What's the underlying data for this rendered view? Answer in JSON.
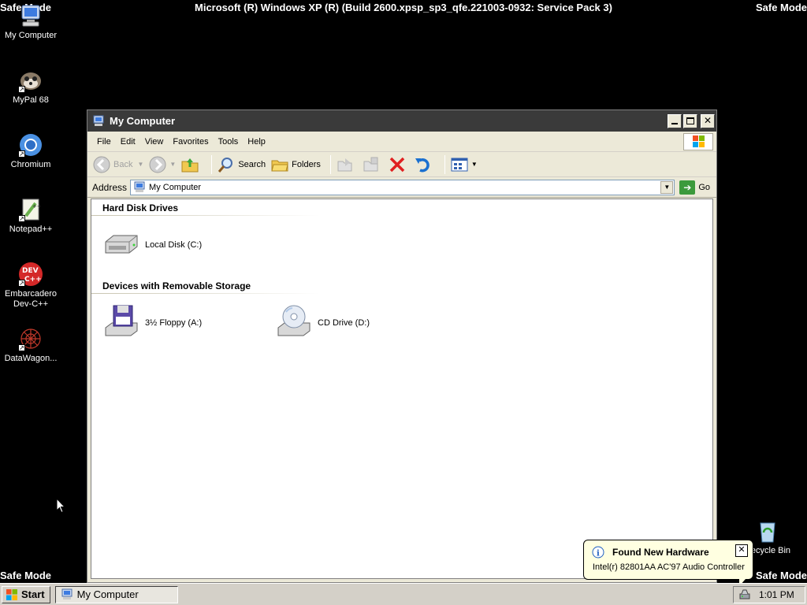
{
  "screen": {
    "safe_mode_label": "Safe Mode",
    "build_text": "Microsoft (R) Windows XP (R) (Build 2600.xpsp_sp3_qfe.221003-0932: Service Pack 3)"
  },
  "desktop_icons": [
    {
      "label": "My Computer",
      "icon": "my-computer-icon"
    },
    {
      "label": "MyPal 68",
      "icon": "mypal-icon"
    },
    {
      "label": "Chromium",
      "icon": "chromium-icon"
    },
    {
      "label": "Notepad++",
      "icon": "notepadpp-icon"
    },
    {
      "label": "Embarcadero Dev-C++",
      "icon": "devcpp-icon"
    },
    {
      "label": "DataWagon...",
      "icon": "datawagon-icon"
    },
    {
      "label": "Recycle Bin",
      "icon": "recycle-bin-icon"
    }
  ],
  "window": {
    "title": "My Computer",
    "menu": [
      "File",
      "Edit",
      "View",
      "Favorites",
      "Tools",
      "Help"
    ],
    "toolbar": {
      "back": "Back",
      "search": "Search",
      "folders": "Folders"
    },
    "address": {
      "label": "Address",
      "value": "My Computer",
      "go": "Go"
    },
    "groups": [
      {
        "title": "Hard Disk Drives",
        "items": [
          {
            "label": "Local Disk (C:)",
            "icon": "hard-disk-icon"
          }
        ]
      },
      {
        "title": "Devices with Removable Storage",
        "items": [
          {
            "label": "3½ Floppy (A:)",
            "icon": "floppy-drive-icon"
          },
          {
            "label": "CD Drive (D:)",
            "icon": "cd-drive-icon"
          }
        ]
      }
    ]
  },
  "balloon": {
    "title": "Found New Hardware",
    "text": "Intel(r) 82801AA AC'97 Audio Controller"
  },
  "taskbar": {
    "start": "Start",
    "task_item": "My Computer",
    "clock": "1:01 PM"
  }
}
